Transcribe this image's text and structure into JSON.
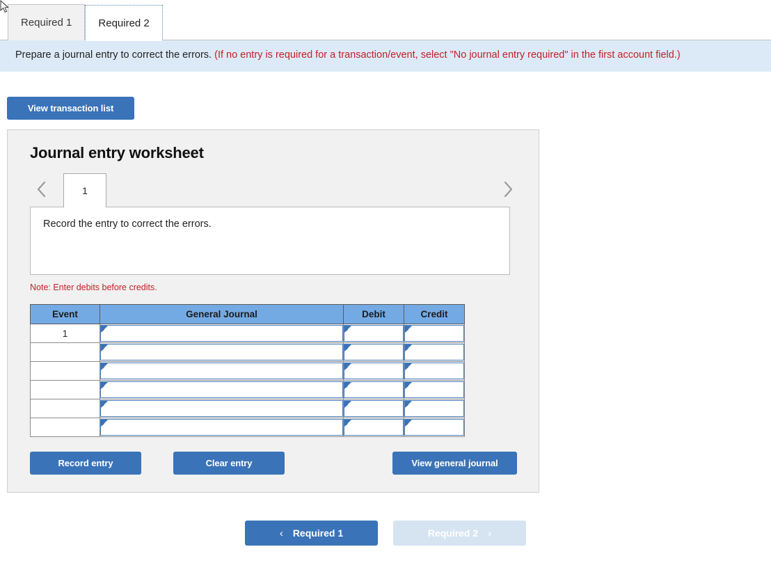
{
  "tabs": [
    {
      "label": "Required 1",
      "active": false
    },
    {
      "label": "Required 2",
      "active": true
    }
  ],
  "banner": {
    "text_black": "Prepare a journal entry to correct the errors.",
    "text_red": "(If no entry is required for a transaction/event, select \"No journal entry required\" in the first account field.)"
  },
  "toolbar": {
    "view_transaction_list": "View transaction list"
  },
  "worksheet": {
    "title": "Journal entry worksheet",
    "pager": {
      "prev_icon": "chevron-left-icon",
      "next_icon": "chevron-right-icon",
      "current_page": "1"
    },
    "description": "Record the entry to correct the errors.",
    "note": "Note: Enter debits before credits.",
    "table": {
      "headers": [
        "Event",
        "General Journal",
        "Debit",
        "Credit"
      ],
      "rows": [
        {
          "event": "1",
          "general_journal": "",
          "debit": "",
          "credit": ""
        },
        {
          "event": "",
          "general_journal": "",
          "debit": "",
          "credit": ""
        },
        {
          "event": "",
          "general_journal": "",
          "debit": "",
          "credit": ""
        },
        {
          "event": "",
          "general_journal": "",
          "debit": "",
          "credit": ""
        },
        {
          "event": "",
          "general_journal": "",
          "debit": "",
          "credit": ""
        },
        {
          "event": "",
          "general_journal": "",
          "debit": "",
          "credit": ""
        }
      ]
    },
    "actions": {
      "record_entry": "Record entry",
      "clear_entry": "Clear entry",
      "view_general_journal": "View general journal"
    }
  },
  "bottom_nav": {
    "prev": {
      "label": "Required 1",
      "arrow": "‹",
      "disabled": false
    },
    "next": {
      "label": "Required 2",
      "arrow": "›",
      "disabled": true
    }
  },
  "colors": {
    "accent_blue": "#3a73b8",
    "header_blue": "#74aae4",
    "banner_blue": "#dceaf7",
    "panel_gray": "#f1f1f1",
    "alert_red": "#c52026",
    "disabled_blue": "#d6e4f2"
  }
}
